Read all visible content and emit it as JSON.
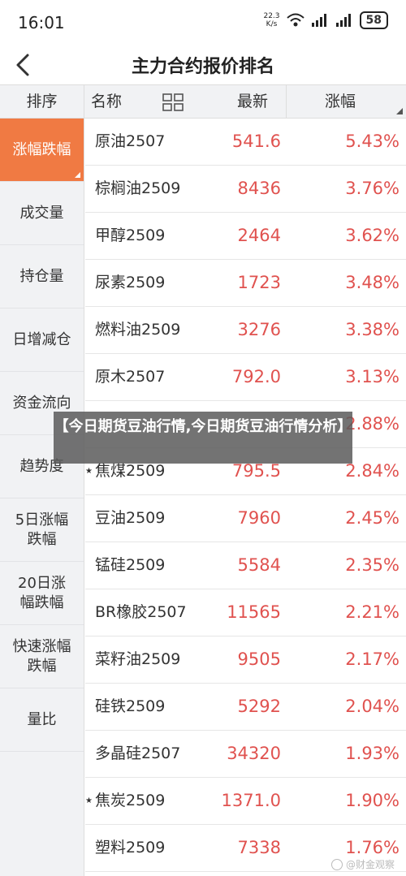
{
  "status": {
    "time": "16:01",
    "net_speed_value": "22.3",
    "net_speed_unit": "K/s",
    "battery": "58"
  },
  "nav": {
    "title": "主力合约报价排名"
  },
  "header": {
    "sort": "排序",
    "name": "名称",
    "latest": "最新",
    "change": "涨幅"
  },
  "sidebar": {
    "items": [
      {
        "label": "涨幅跌幅",
        "active": true
      },
      {
        "label": "成交量"
      },
      {
        "label": "持仓量"
      },
      {
        "label": "日增减仓"
      },
      {
        "label": "资金流向"
      },
      {
        "label": "趋势度"
      },
      {
        "label": "5日涨幅\n跌幅"
      },
      {
        "label": "20日涨\n幅跌幅"
      },
      {
        "label": "快速涨幅\n跌幅"
      },
      {
        "label": "量比"
      }
    ]
  },
  "rows": [
    {
      "name": "原油2507",
      "price": "541.6",
      "change": "5.43%",
      "star": ""
    },
    {
      "name": "棕榈油2509",
      "price": "8436",
      "change": "3.76%",
      "star": ""
    },
    {
      "name": "甲醇2509",
      "price": "2464",
      "change": "3.62%",
      "star": ""
    },
    {
      "name": "尿素2509",
      "price": "1723",
      "change": "3.48%",
      "star": ""
    },
    {
      "name": "燃料油2509",
      "price": "3276",
      "change": "3.38%",
      "star": ""
    },
    {
      "name": "原木2507",
      "price": "792.0",
      "change": "3.13%",
      "star": ""
    },
    {
      "name": "",
      "price": "",
      "change": "2.88%",
      "star": ""
    },
    {
      "name": "焦煤2509",
      "price": "795.5",
      "change": "2.84%",
      "star": "★"
    },
    {
      "name": "豆油2509",
      "price": "7960",
      "change": "2.45%",
      "star": ""
    },
    {
      "name": "锰硅2509",
      "price": "5584",
      "change": "2.35%",
      "star": ""
    },
    {
      "name": "BR橡胶2507",
      "price": "11565",
      "change": "2.21%",
      "star": ""
    },
    {
      "name": "菜籽油2509",
      "price": "9505",
      "change": "2.17%",
      "star": ""
    },
    {
      "name": "硅铁2509",
      "price": "5292",
      "change": "2.04%",
      "star": ""
    },
    {
      "name": "多晶硅2507",
      "price": "34320",
      "change": "1.93%",
      "star": ""
    },
    {
      "name": "焦炭2509",
      "price": "1371.0",
      "change": "1.90%",
      "star": "★"
    },
    {
      "name": "塑料2509",
      "price": "7338",
      "change": "1.76%",
      "star": ""
    }
  ],
  "overlay": {
    "text": "【今日期货豆油行情,今日期货豆油行情分析】"
  },
  "watermark": {
    "text": "@财金观察"
  },
  "colors": {
    "accent": "#f07a43",
    "up": "#e0524f"
  }
}
